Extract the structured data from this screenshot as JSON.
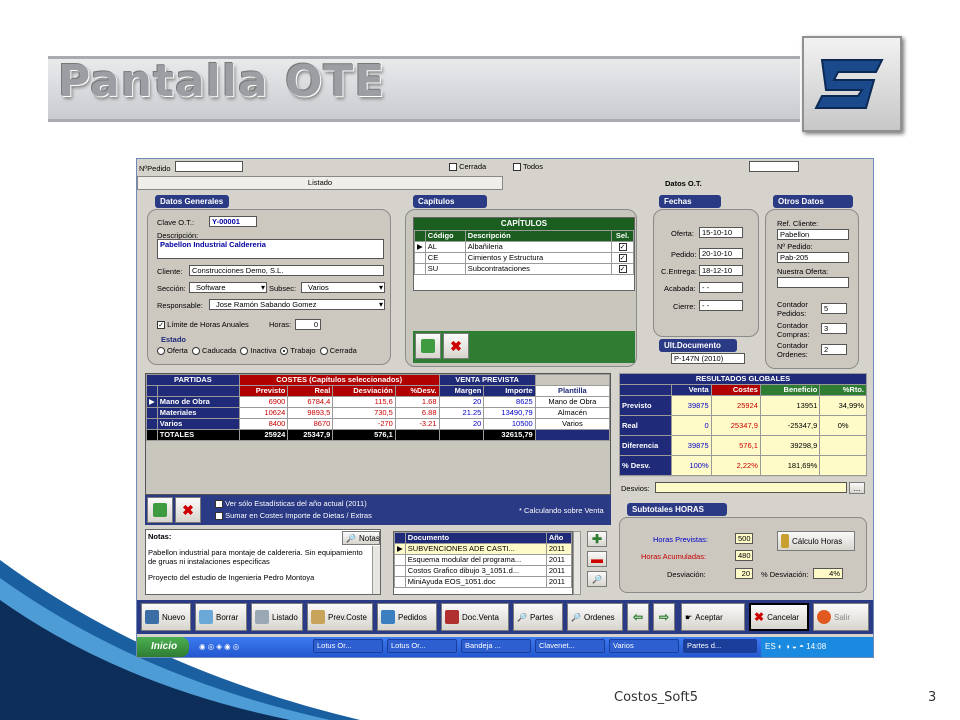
{
  "slide": {
    "title": "Pantalla OTE",
    "footer": "Costos_Soft5",
    "page": "3"
  },
  "top": {
    "pedido_label": "NºPedido",
    "cerrada": "Cerrada",
    "todos": "Todos",
    "listado_tab": "Listado",
    "datos_ot": "Datos O.T."
  },
  "general": {
    "title": "Datos Generales",
    "clave_label": "Clave O.T.:",
    "clave": "Y-00001",
    "descripcion_label": "Descripción:",
    "descripcion": "Pabellon Industrial Caldereria",
    "cliente_label": "Cliente:",
    "cliente": "Construcciones Demo, S.L.",
    "seccion_label": "Sección:",
    "seccion": "Software",
    "subsec_label": "Subsec:",
    "subsec": "Varios",
    "responsable_label": "Responsable:",
    "responsable": "Jose Ramón Sabando Gomez",
    "limite_label": "Límite de Horas Anuales",
    "horas_label": "Horas:",
    "horas": "0",
    "estado_label": "Estado",
    "estados": [
      "Oferta",
      "Caducada",
      "Inactiva",
      "Trabajo",
      "Cerrada"
    ],
    "estado_sel": 3
  },
  "capitulos": {
    "title": "Capítulos",
    "grid_title": "CAPÍTULOS",
    "cols": [
      "Código",
      "Descripción",
      "Sel."
    ],
    "rows": [
      [
        "AL",
        "Albañileria"
      ],
      [
        "CE",
        "Cimientos y Estructura"
      ],
      [
        "SU",
        "Subcontrataciones"
      ]
    ]
  },
  "fechas": {
    "title": "Fechas",
    "items": [
      [
        "Oferta:",
        "15-10-10"
      ],
      [
        "Pedido:",
        "20-10-10"
      ],
      [
        "C.Entrega:",
        "18-12-10"
      ],
      [
        "Acabada:",
        " -  -"
      ],
      [
        "Cierre:",
        " -  -"
      ]
    ],
    "ult_title": "Ult.Documento",
    "ult": "P-147N (2010)"
  },
  "otros": {
    "title": "Otros Datos",
    "ref_label": "Ref. Cliente:",
    "ref": "Pabellon",
    "ped_label": "Nº Pedido:",
    "ped": "Pab-205",
    "oferta_label": "Nuestra Oferta:",
    "oferta": "",
    "c1_label": "Contador Pedidos:",
    "c1": "5",
    "c2_label": "Contador Compras:",
    "c2": "3",
    "c3_label": "Contador Ordenes:",
    "c3": "2"
  },
  "partidas": {
    "h_partidas": "PARTIDAS",
    "h_costes": "COSTES (Capítulos seleccionados)",
    "h_venta": "VENTA PREVISTA",
    "cols": [
      "Previsto",
      "Real",
      "Desviación",
      "%Desv.",
      "Margen",
      "Importe",
      "Plantilla"
    ],
    "rows": [
      {
        "name": "Mano de Obra",
        "v": [
          "6900",
          "6784,4",
          "115,6",
          "1.68",
          "20",
          "8625",
          "Mano de Obra"
        ]
      },
      {
        "name": "Materiales",
        "v": [
          "10624",
          "9893,5",
          "730,5",
          "6.88",
          "21.25",
          "13490,79",
          "Almacén"
        ]
      },
      {
        "name": "Varios",
        "v": [
          "8400",
          "8670",
          "-270",
          "-3.21",
          "20",
          "10500",
          "Varios"
        ]
      }
    ],
    "totales": {
      "name": "TOTALES",
      "v": [
        "25924",
        "25347,9",
        "576,1",
        "",
        "",
        "32615,79",
        ""
      ]
    },
    "opt1": "Ver sólo Estadísticas del año actual (2011)",
    "opt2": "Sumar en Costes Importe de Dietas / Extras",
    "nota": "* Calculando sobre Venta"
  },
  "resultados": {
    "title": "RESULTADOS GLOBALES",
    "cols": [
      "Venta",
      "Costes",
      "Beneficio",
      "%Rto."
    ],
    "rows": [
      {
        "name": "Previsto",
        "v": [
          "39875",
          "25924",
          "13951",
          "34,99%"
        ]
      },
      {
        "name": "Real",
        "v": [
          "0",
          "25347,9",
          "-25347,9",
          "0%"
        ]
      },
      {
        "name": "Diferencia",
        "v": [
          "39875",
          "576,1",
          "39298,9",
          ""
        ]
      },
      {
        "name": "% Desv.",
        "v": [
          "100%",
          "2,22%",
          "181,69%",
          ""
        ]
      }
    ],
    "desvios_label": "Desvios:",
    "dots": "..."
  },
  "subtotales": {
    "title": "Subtotales HORAS",
    "prev_label": "Horas Previstas:",
    "prev": "500",
    "acum_label": "Horas Acumuladas:",
    "acum": "480",
    "desv_label": "Desviación:",
    "desv": "20",
    "pct_label": "% Desviación:",
    "pct": "4%",
    "calc": "Cálculo Horas"
  },
  "notas": {
    "label": "Notas:",
    "btn": "Notas",
    "text1": "Pabellon industrial para montaje de caldereria. Sin equipamiento de gruas ni instalaciones especificas",
    "text2": "Proyecto del estudio de Ingenieria Pedro Montoya"
  },
  "docs": {
    "cols": [
      "Documento",
      "Año"
    ],
    "rows": [
      [
        "SUBVENCIONES ADE CASTI...",
        "2011"
      ],
      [
        "Esquema modular del programa...",
        "2011"
      ],
      [
        "Costos Grafico dibujo 3_1051.d...",
        "2011"
      ],
      [
        "MiniAyuda EOS_1051.doc",
        "2011"
      ]
    ]
  },
  "toolbar": [
    "Nuevo",
    "Borrar",
    "Listado",
    "Prev.Coste",
    "Pedidos",
    "Doc.Venta",
    "Partes",
    "Ordenes",
    "Aceptar",
    "Cancelar",
    "Salir"
  ],
  "taskbar": {
    "start": "Inicio",
    "items": [
      "Lotus Or...",
      "Lotus Or...",
      "Bandeja ...",
      "Clavenet...",
      "Varios",
      "Partes d..."
    ],
    "lang": "ES",
    "time": "14:08"
  },
  "colors": {
    "navy": "#1f2a78",
    "blue": "#2b3a84",
    "green": "#2e7d32",
    "yellow": "#fffbc8",
    "red": "#b00000"
  }
}
